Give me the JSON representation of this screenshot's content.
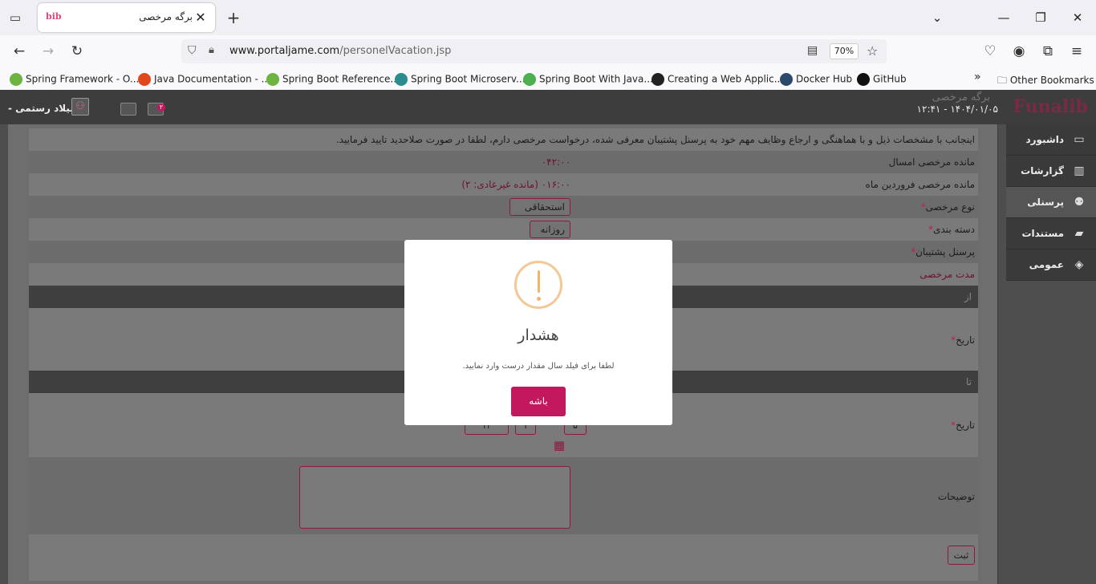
{
  "browser": {
    "tab_title": "برگه مرخصی",
    "favicon_text": "bib",
    "url_domain": "www.portaljame.com",
    "url_path": "/personelVacation.jsp",
    "zoom": "70%",
    "bookmarks": [
      {
        "label": "Spring Framework - O...",
        "color": "#6db33f"
      },
      {
        "label": "Java Documentation - ...",
        "color": "#e2461d"
      },
      {
        "label": "Spring Boot Reference...",
        "color": "#6db33f"
      },
      {
        "label": "Spring Boot Microserv...",
        "color": "#2a8c8c"
      },
      {
        "label": "Spring Boot With Java...",
        "color": "#4caf50"
      },
      {
        "label": "Creating a Web Applic...",
        "color": "#222222"
      },
      {
        "label": "Docker Hub",
        "color": "#2b4a6b"
      },
      {
        "label": "GitHub",
        "color": "#111111"
      }
    ],
    "other_bookmarks": "Other Bookmarks"
  },
  "app": {
    "brand": "Funalib",
    "page_title": "برگه مرخصی",
    "datetime": "۱۴۰۴/۰۱/۰۵ - ۱۲:۴۱",
    "username": "میلاد رستمی -",
    "notification_count": "۲",
    "nav": [
      {
        "label": "داشبورد",
        "icon": "monitor-icon"
      },
      {
        "label": "گزارشات",
        "icon": "report-icon"
      },
      {
        "label": "پرسنلی",
        "icon": "users-icon"
      },
      {
        "label": "مستندات",
        "icon": "book-icon"
      },
      {
        "label": "عمومی",
        "icon": "layers-icon"
      }
    ]
  },
  "form": {
    "intro": "اینجانب با مشخصات ذیل و با هماهنگی و ارجاع وظایف مهم خود به پرسنل پشتیبان معرفی شده، درخواست مرخصی دارم، لطفا در صورت صلاحدید تایید فرمایید.",
    "remaining_year_label": "مانده مرخصی امسال",
    "remaining_year_value": "۰۴۲:۰۰",
    "remaining_month_label": "مانده مرخصی فروردین ماه",
    "remaining_month_value": "۰۱۶:۰۰ (مانده غیرعادی: ۲)",
    "type_label": "نوع مرخصی",
    "type_value": "استحقاقی",
    "category_label": "دسته بندی",
    "category_value": "روزانه",
    "backup_label": "پرسنل پشتیبان",
    "duration_label": "مدت مرخصی",
    "from_label": "از",
    "date_label": "تاریخ",
    "to_label": "تا",
    "to_day": "۵",
    "to_month": "۱",
    "to_year": "۱۴",
    "desc_label": "توضیحات",
    "submit": "ثبت",
    "required_mark": "*"
  },
  "modal": {
    "title": "هشدار",
    "message": "لطفا برای فیلد سال مقدار درست وارد نمایید.",
    "ok": "باشه"
  }
}
